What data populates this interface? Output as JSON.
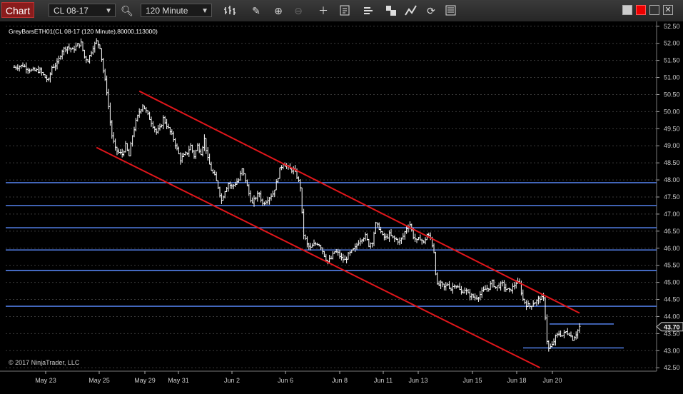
{
  "toolbar": {
    "chart_label": "Chart",
    "instrument": "CL 08-17",
    "interval": "120 Minute"
  },
  "chart": {
    "indicator_label": "GreyBarsETH01(CL 08-17 (120 Minute),80000,113000)",
    "copyright": "© 2017 NinjaTrader, LLC",
    "last_price_label": "43.70",
    "colors": {
      "background": "#000000",
      "bars": "#ffffff",
      "channel": "#e0161b",
      "levels": "#5b8cff",
      "grid": "#3a3a3a"
    }
  },
  "chart_data": {
    "type": "candlestick",
    "instrument": "CL 08-17",
    "interval": "120 Minute",
    "ylim": [
      42.4,
      52.6
    ],
    "y_ticks": [
      "52.50",
      "52.00",
      "51.50",
      "51.00",
      "50.50",
      "50.00",
      "49.50",
      "49.00",
      "48.50",
      "48.00",
      "47.50",
      "47.00",
      "46.50",
      "46.00",
      "45.50",
      "45.00",
      "44.50",
      "44.00",
      "43.50",
      "43.00",
      "42.50"
    ],
    "x_ticks": [
      "May 23",
      "May 25",
      "May 29",
      "May 31",
      "Jun 2",
      "Jun 6",
      "Jun 8",
      "Jun 11",
      "Jun 13",
      "Jun 15",
      "Jun 18",
      "Jun 20"
    ],
    "last_price": 43.7,
    "horizontal_levels": [
      47.92,
      47.25,
      46.6,
      45.95,
      45.35,
      44.3
    ],
    "short_levels": [
      43.78,
      43.08
    ],
    "channel_lines": [
      {
        "name": "upper",
        "from": {
          "bar": 73,
          "price": 50.6
        },
        "to": {
          "bar": 330,
          "price": 44.1
        }
      },
      {
        "name": "lower",
        "from": {
          "bar": 48,
          "price": 48.95
        },
        "to": {
          "bar": 307,
          "price": 42.5
        }
      }
    ],
    "price_path": [
      [
        0,
        51.3
      ],
      [
        5,
        51.35
      ],
      [
        10,
        51.2
      ],
      [
        15,
        51.2
      ],
      [
        18,
        51.0
      ],
      [
        20,
        50.9
      ],
      [
        22,
        51.3
      ],
      [
        25,
        51.4
      ],
      [
        28,
        51.8
      ],
      [
        31,
        51.9
      ],
      [
        34,
        51.8
      ],
      [
        37,
        51.95
      ],
      [
        39,
        52.0
      ],
      [
        41,
        51.6
      ],
      [
        43,
        51.5
      ],
      [
        46,
        51.9
      ],
      [
        48,
        52.05
      ],
      [
        50,
        51.9
      ],
      [
        52,
        51.2
      ],
      [
        54,
        50.6
      ],
      [
        56,
        49.7
      ],
      [
        57,
        49.3
      ],
      [
        59,
        48.9
      ],
      [
        61,
        48.8
      ],
      [
        63,
        48.75
      ],
      [
        65,
        49.0
      ],
      [
        67,
        48.7
      ],
      [
        69,
        49.3
      ],
      [
        71,
        49.7
      ],
      [
        73,
        50.0
      ],
      [
        75,
        50.2
      ],
      [
        77,
        50.0
      ],
      [
        79,
        49.8
      ],
      [
        81,
        49.6
      ],
      [
        83,
        49.4
      ],
      [
        85,
        49.5
      ],
      [
        87,
        49.8
      ],
      [
        89,
        49.6
      ],
      [
        91,
        49.4
      ],
      [
        93,
        49.2
      ],
      [
        95,
        48.9
      ],
      [
        97,
        48.6
      ],
      [
        99,
        48.7
      ],
      [
        101,
        48.8
      ],
      [
        103,
        49.0
      ],
      [
        105,
        48.7
      ],
      [
        107,
        49.0
      ],
      [
        109,
        48.8
      ],
      [
        111,
        49.2
      ],
      [
        113,
        48.6
      ],
      [
        115,
        48.3
      ],
      [
        117,
        48.1
      ],
      [
        119,
        47.8
      ],
      [
        121,
        47.4
      ],
      [
        123,
        47.7
      ],
      [
        125,
        47.9
      ],
      [
        127,
        47.8
      ],
      [
        129,
        47.9
      ],
      [
        131,
        48.0
      ],
      [
        133,
        48.3
      ],
      [
        135,
        48.0
      ],
      [
        137,
        47.6
      ],
      [
        139,
        47.3
      ],
      [
        141,
        47.5
      ],
      [
        143,
        47.6
      ],
      [
        145,
        47.3
      ],
      [
        147,
        47.4
      ],
      [
        149,
        47.5
      ],
      [
        151,
        47.6
      ],
      [
        153,
        47.9
      ],
      [
        155,
        48.3
      ],
      [
        157,
        48.5
      ],
      [
        159,
        48.4
      ],
      [
        161,
        48.3
      ],
      [
        163,
        48.3
      ],
      [
        165,
        48.1
      ],
      [
        167,
        47.8
      ],
      [
        168,
        47.0
      ],
      [
        169,
        46.4
      ],
      [
        171,
        46.1
      ],
      [
        173,
        46.0
      ],
      [
        175,
        46.1
      ],
      [
        177,
        46.15
      ],
      [
        179,
        46.05
      ],
      [
        181,
        45.8
      ],
      [
        183,
        45.6
      ],
      [
        185,
        45.7
      ],
      [
        187,
        45.9
      ],
      [
        189,
        45.85
      ],
      [
        191,
        45.7
      ],
      [
        193,
        45.65
      ],
      [
        195,
        45.8
      ],
      [
        197,
        45.9
      ],
      [
        199,
        46.0
      ],
      [
        201,
        46.2
      ],
      [
        203,
        46.3
      ],
      [
        205,
        46.35
      ],
      [
        207,
        46.1
      ],
      [
        209,
        46.2
      ],
      [
        211,
        46.7
      ],
      [
        213,
        46.6
      ],
      [
        215,
        46.35
      ],
      [
        217,
        46.3
      ],
      [
        219,
        46.4
      ],
      [
        221,
        46.3
      ],
      [
        223,
        46.25
      ],
      [
        225,
        46.2
      ],
      [
        227,
        46.35
      ],
      [
        229,
        46.6
      ],
      [
        231,
        46.7
      ],
      [
        233,
        46.35
      ],
      [
        235,
        46.2
      ],
      [
        237,
        46.3
      ],
      [
        239,
        46.15
      ],
      [
        241,
        46.4
      ],
      [
        243,
        46.3
      ],
      [
        245,
        45.9
      ],
      [
        246,
        45.3
      ],
      [
        247,
        44.9
      ],
      [
        249,
        44.95
      ],
      [
        251,
        44.85
      ],
      [
        253,
        44.95
      ],
      [
        255,
        44.8
      ],
      [
        257,
        44.95
      ],
      [
        259,
        44.85
      ],
      [
        261,
        44.7
      ],
      [
        263,
        44.8
      ],
      [
        265,
        44.65
      ],
      [
        267,
        44.6
      ],
      [
        269,
        44.55
      ],
      [
        271,
        44.6
      ],
      [
        273,
        44.7
      ],
      [
        275,
        44.8
      ],
      [
        277,
        44.85
      ],
      [
        279,
        45.0
      ],
      [
        281,
        44.85
      ],
      [
        283,
        44.9
      ],
      [
        285,
        44.95
      ],
      [
        287,
        44.8
      ],
      [
        289,
        44.75
      ],
      [
        291,
        44.85
      ],
      [
        293,
        45.0
      ],
      [
        295,
        44.95
      ],
      [
        297,
        44.5
      ],
      [
        299,
        44.35
      ],
      [
        301,
        44.3
      ],
      [
        303,
        44.4
      ],
      [
        305,
        44.45
      ],
      [
        307,
        44.55
      ],
      [
        309,
        44.5
      ],
      [
        310,
        44.0
      ],
      [
        311,
        43.3
      ],
      [
        312,
        43.05
      ],
      [
        314,
        43.15
      ],
      [
        316,
        43.4
      ],
      [
        318,
        43.5
      ],
      [
        320,
        43.45
      ],
      [
        322,
        43.55
      ],
      [
        324,
        43.5
      ],
      [
        326,
        43.35
      ],
      [
        328,
        43.5
      ],
      [
        330,
        43.7
      ]
    ]
  }
}
